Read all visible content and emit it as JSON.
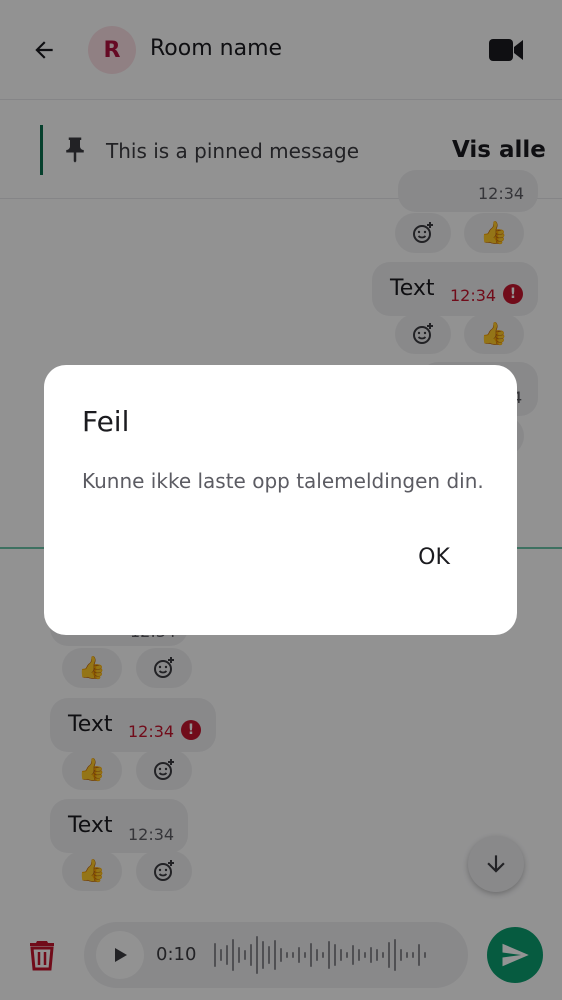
{
  "header": {
    "avatar_letter": "R",
    "room_name": "Room name",
    "back_icon": "arrow-back-icon",
    "video_icon": "video-call-icon"
  },
  "pinned": {
    "text": "This is a pinned message",
    "view_all": "Vis alle",
    "icon": "pin-icon"
  },
  "messages": {
    "partial_top_time": "12:34",
    "sent_failed": {
      "text": "Text",
      "time": "12:34",
      "error_mark": "!"
    },
    "partial_mid_time": "4",
    "received_top_time": "12:34",
    "received_failed": {
      "text": "Text",
      "time": "12:34",
      "error_mark": "!"
    },
    "received_ok": {
      "text": "Text",
      "time": "12:34"
    },
    "thumb_reaction": "👍"
  },
  "composer": {
    "voice_duration": "0:10",
    "delete_icon": "trash-icon",
    "play_icon": "play-icon",
    "send_icon": "send-icon"
  },
  "dialog": {
    "title": "Feil",
    "message": "Kunne ikke laste opp talemeldingen din.",
    "ok_label": "OK"
  },
  "colors": {
    "accent": "#0b9e6f",
    "pinned_bar": "#0b6e4f",
    "error": "#c3152e",
    "avatar_bg": "#f8dde2",
    "avatar_fg": "#b0123e",
    "bubble": "#ececee"
  }
}
